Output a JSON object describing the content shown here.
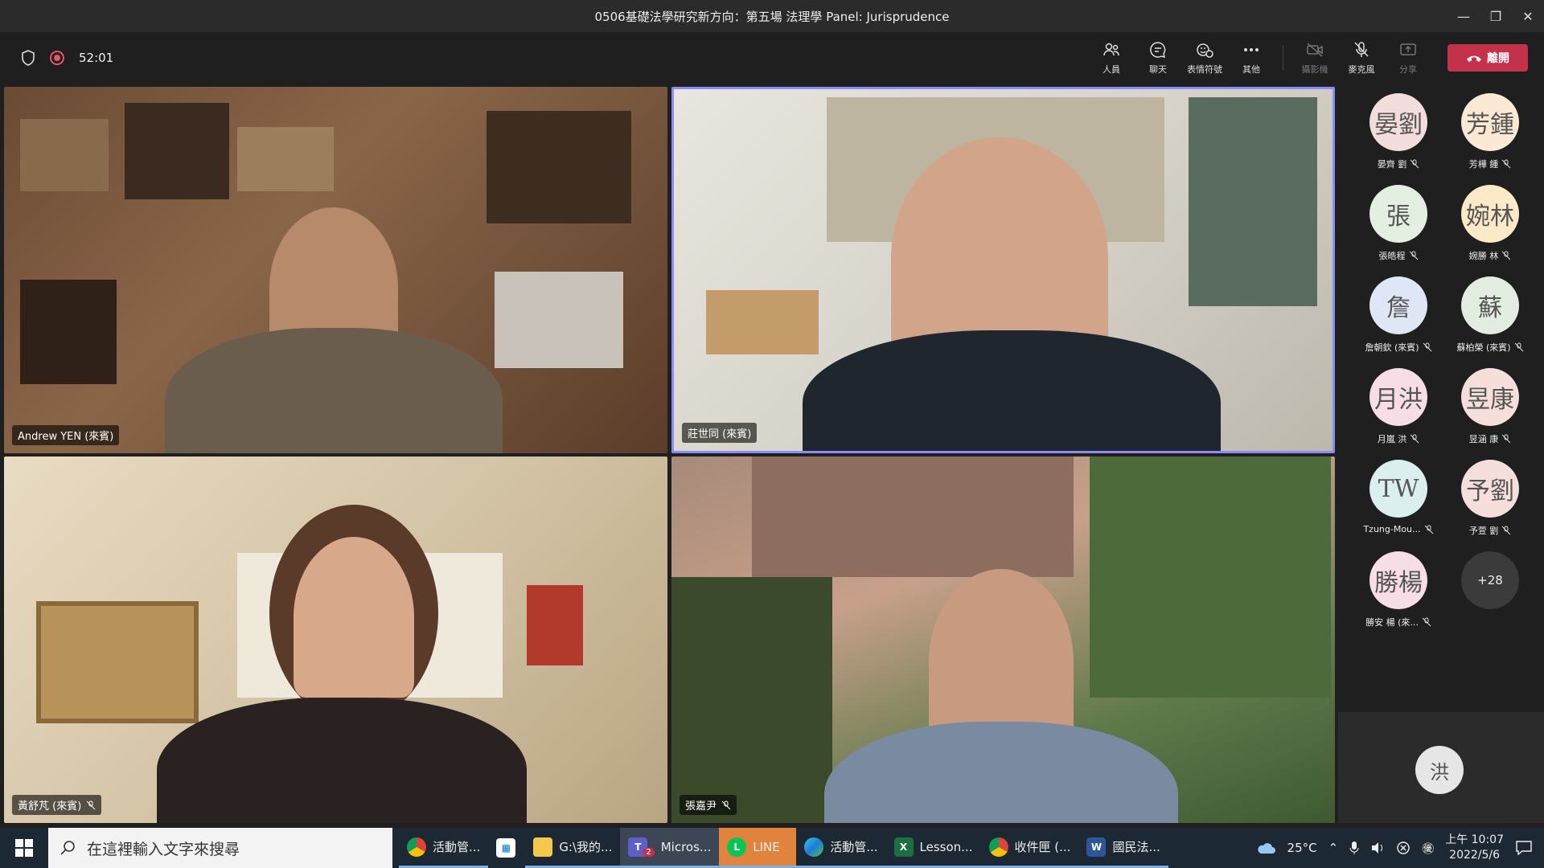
{
  "window": {
    "title": "0506基礎法學研究新方向：第五場 法理學 Panel: Jurisprudence"
  },
  "toolbar": {
    "timer": "52:01",
    "buttons": [
      {
        "label": "人員",
        "icon": "people-icon"
      },
      {
        "label": "聊天",
        "icon": "chat-icon"
      },
      {
        "label": "表情符號",
        "icon": "reactions-icon"
      },
      {
        "label": "其他",
        "icon": "more-icon"
      },
      {
        "label": "攝影機",
        "icon": "camera-off-icon"
      },
      {
        "label": "麥克風",
        "icon": "mic-off-icon"
      },
      {
        "label": "分享",
        "icon": "share-icon"
      }
    ],
    "leave_label": "離開"
  },
  "videos": [
    {
      "name": "Andrew YEN (來賓)",
      "muted": false
    },
    {
      "name": "莊世同 (來賓)",
      "muted": false,
      "active_speaker": true
    },
    {
      "name": "黃舒芃 (來賓)",
      "muted": true
    },
    {
      "name": "張嘉尹",
      "muted": true
    }
  ],
  "participants": [
    {
      "initials": "晏劉",
      "name": "晏齊 劉",
      "color": "#f3dcdc"
    },
    {
      "initials": "芳鍾",
      "name": "芳樺 鍾",
      "color": "#fbe9d5"
    },
    {
      "initials": "張",
      "name": "張皓程",
      "color": "#e3efe0"
    },
    {
      "initials": "婉林",
      "name": "婉勝 林",
      "color": "#fbe9c8"
    },
    {
      "initials": "詹",
      "name": "詹朝欽 (來賓)",
      "color": "#dfe6f5"
    },
    {
      "initials": "蘇",
      "name": "蘇柏榮 (來賓)",
      "color": "#e3ece0"
    },
    {
      "initials": "月洪",
      "name": "月嵐 洪",
      "color": "#f6dde6"
    },
    {
      "initials": "昱康",
      "name": "昱涵 康",
      "color": "#f6dfda"
    },
    {
      "initials": "TW",
      "name": "Tzung-Mou...",
      "color": "#dcefef"
    },
    {
      "initials": "予劉",
      "name": "予萱 劉",
      "color": "#f6dfda"
    },
    {
      "initials": "勝楊",
      "name": "勝安 楊 (來...",
      "color": "#f6dde6"
    }
  ],
  "more_count": "+28",
  "self_avatar": "洪",
  "taskbar": {
    "search_placeholder": "在這裡輸入文字來搜尋",
    "tasks": [
      {
        "label": "活動管...",
        "icon": "chrome-icon",
        "badge": ""
      },
      {
        "label": "",
        "icon": "store-icon",
        "badge": ""
      },
      {
        "label": "G:\\我的...",
        "icon": "folder-icon",
        "badge": ""
      },
      {
        "label": "Micros...",
        "icon": "teams-icon",
        "badge": "2"
      },
      {
        "label": "LINE",
        "icon": "line-icon",
        "badge": ""
      },
      {
        "label": "活動管...",
        "icon": "edge-icon",
        "badge": ""
      },
      {
        "label": "Lesson...",
        "icon": "excel-icon",
        "badge": ""
      },
      {
        "label": "收件匣 (...",
        "icon": "chrome-icon",
        "badge": ""
      },
      {
        "label": "國民法...",
        "icon": "word-icon",
        "badge": ""
      }
    ],
    "temperature": "25°C",
    "time": "上午 10:07",
    "date": "2022/5/6"
  }
}
